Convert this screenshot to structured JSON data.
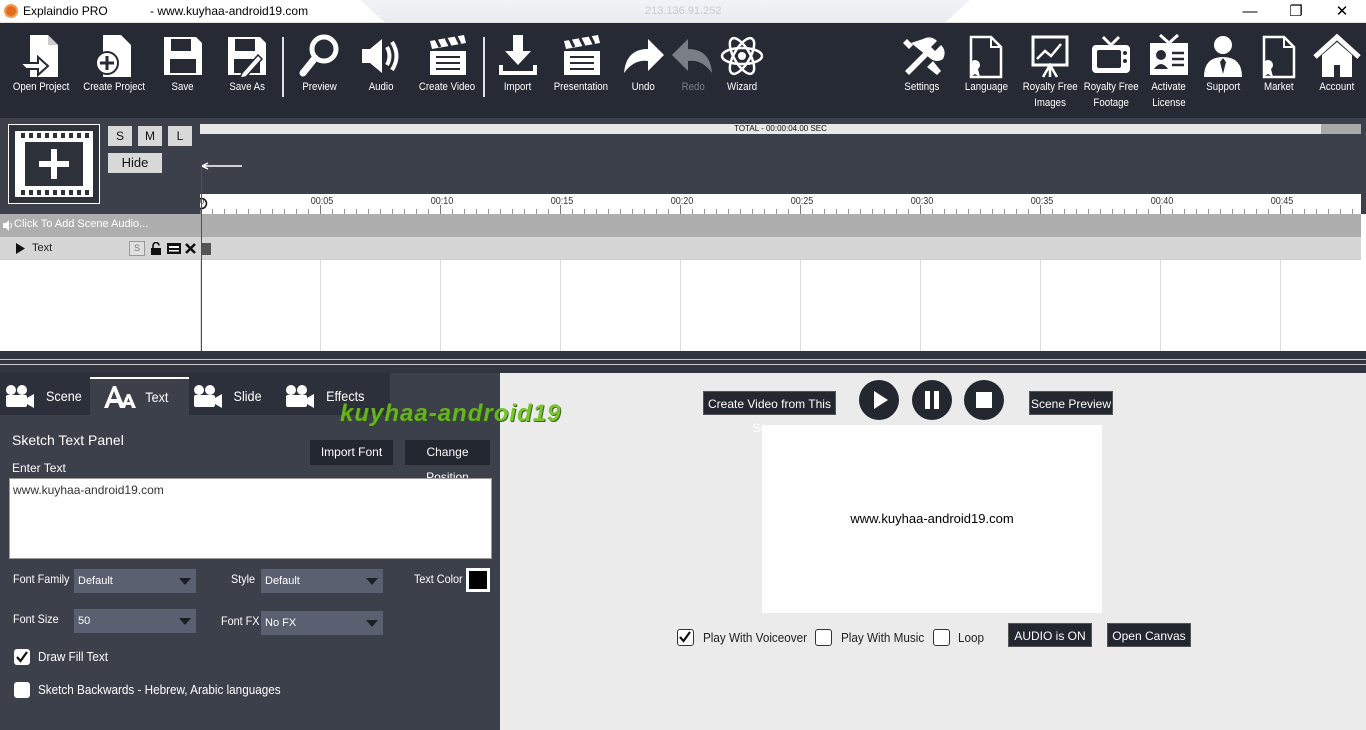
{
  "window": {
    "app_title": "Explaindio PRO",
    "url": "- www.kuyhaa-android19.com",
    "ip": "213.136.91.252",
    "minimize": "—",
    "maximize": "❐",
    "close": "✕"
  },
  "toolbar": {
    "open_project": "Open Project",
    "create_project": "Create Project",
    "save": "Save",
    "save_as": "Save As",
    "preview": "Preview",
    "audio": "Audio",
    "create_video": "Create Video",
    "import": "Import",
    "presentation": "Presentation",
    "undo": "Undo",
    "redo": "Redo",
    "wizard": "Wizard",
    "settings": "Settings",
    "language": "Language",
    "royalty_images": [
      "Royalty Free",
      "Images"
    ],
    "royalty_footage": [
      "Royalty Free",
      "Footage"
    ],
    "activate_license": [
      "Activate",
      "License"
    ],
    "support": "Support",
    "market": "Market",
    "account": "Account"
  },
  "timeline": {
    "size_s": "S",
    "size_m": "M",
    "size_l": "L",
    "hide": "Hide",
    "total": "TOTAL -  00:00:04.00 SEC",
    "ruler_start": "0",
    "ruler_labels": [
      "00:05",
      "00:10",
      "00:15",
      "00:20",
      "00:25",
      "00:30",
      "00:35",
      "00:40",
      "00:45"
    ],
    "audio_track": "Click To Add Scene Audio...",
    "text_track": "Text",
    "text_track_s": "S"
  },
  "tabs": [
    {
      "label": "Scene",
      "icon": "camera-icon"
    },
    {
      "label": "Text",
      "icon": "text-icon"
    },
    {
      "label": "Slide",
      "icon": "camera-icon"
    },
    {
      "label": "Effects",
      "icon": "camera-icon"
    }
  ],
  "text_panel": {
    "title": "Sketch Text Panel",
    "import_font": "Import Font",
    "change_position": "Change Position",
    "enter_text_label": "Enter Text",
    "text_value": "www.kuyhaa-android19.com",
    "font_family_label": "Font Family",
    "font_family_value": "Default",
    "style_label": "Style",
    "style_value": "Default",
    "text_color_label": "Text Color",
    "text_color": "#000000",
    "font_size_label": "Font Size",
    "font_size_value": "50",
    "font_fx_label": "Font FX",
    "font_fx_value": "No FX",
    "draw_fill_label": "Draw Fill Text",
    "draw_fill_checked": true,
    "sketch_backwards_label": "Sketch Backwards - Hebrew, Arabic languages",
    "sketch_backwards_checked": false
  },
  "preview_panel": {
    "create_video_scene": "Create Video from This Scene",
    "scene_preview": "Scene Preview",
    "canvas_text": "www.kuyhaa-android19.com",
    "play_voiceover": "Play With Voiceover",
    "play_voiceover_checked": true,
    "play_music": "Play With Music",
    "play_music_checked": false,
    "loop": "Loop",
    "loop_checked": false,
    "audio_status": "AUDIO is ON",
    "open_canvas": "Open Canvas"
  },
  "watermark": "kuyhaa-android19",
  "colors": {
    "toolbar_bg": "#252a34",
    "panel_bg": "#3b404b",
    "playhead": "#c0211f",
    "watermark": "#6fbf1d"
  }
}
